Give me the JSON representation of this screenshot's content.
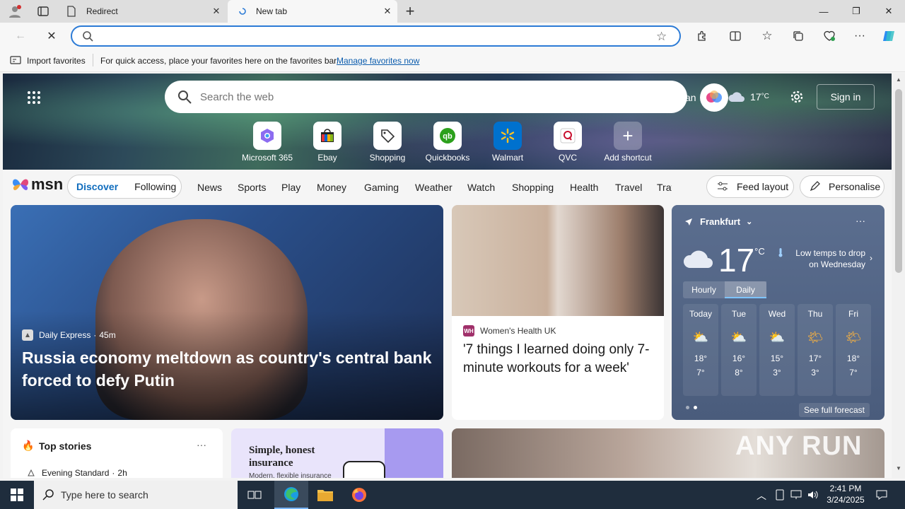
{
  "browser": {
    "tabs": [
      {
        "title": "Redirect",
        "active": false
      },
      {
        "title": "New tab",
        "active": true
      }
    ],
    "address_placeholder": "",
    "favorites_bar": {
      "import_label": "Import favorites",
      "message": "For quick access, place your favorites here on the favorites bar.",
      "manage_link": "Manage favorites now"
    }
  },
  "newtab": {
    "search_placeholder": "Search the web",
    "weather_mini": "17",
    "weather_unit": "°C",
    "signin_label": "Sign in",
    "partial_text": "an",
    "shortcuts": [
      {
        "label": "Microsoft 365",
        "icon": "microsoft-365-icon"
      },
      {
        "label": "Ebay",
        "icon": "ebay-icon"
      },
      {
        "label": "Shopping",
        "icon": "tag-icon"
      },
      {
        "label": "Quickbooks",
        "icon": "quickbooks-icon"
      },
      {
        "label": "Walmart",
        "icon": "walmart-icon"
      },
      {
        "label": "QVC",
        "icon": "qvc-icon"
      },
      {
        "label": "Add shortcut",
        "icon": "plus-icon"
      }
    ]
  },
  "msn": {
    "logo_text": "msn",
    "primary_tabs": [
      "Discover",
      "Following"
    ],
    "nav_links": [
      "News",
      "Sports",
      "Play",
      "Money",
      "Gaming",
      "Weather",
      "Watch",
      "Shopping",
      "Health",
      "Travel",
      "Trav"
    ],
    "feed_layout_label": "Feed layout",
    "personalise_label": "Personalise"
  },
  "cards": {
    "main": {
      "source": "Daily Express",
      "age": "45m",
      "headline": "Russia economy meltdown as country's central bank forced to defy Putin"
    },
    "second": {
      "source": "Women's Health UK",
      "headline": "'7 things I learned doing only 7-minute workouts for a week'"
    },
    "top_stories": {
      "title": "Top stories",
      "more": "···",
      "first_source": "Evening Standard",
      "first_age": "2h"
    },
    "ad": {
      "title": "Simple, honest insurance",
      "sub": "Modern, flexible insurance"
    }
  },
  "weather": {
    "location": "Frankfurt",
    "temp": "17",
    "unit": "°C",
    "alert": "Low temps to drop on Wednesday",
    "tabs": [
      "Hourly",
      "Daily"
    ],
    "days": [
      {
        "day": "Today",
        "high": "18°",
        "low": "7°"
      },
      {
        "day": "Tue",
        "high": "16°",
        "low": "8°"
      },
      {
        "day": "Wed",
        "high": "15°",
        "low": "3°"
      },
      {
        "day": "Thu",
        "high": "17°",
        "low": "3°"
      },
      {
        "day": "Fri",
        "high": "18°",
        "low": "7°"
      }
    ],
    "see_full": "See full forecast"
  },
  "taskbar": {
    "search_placeholder": "Type here to search",
    "time": "2:41 PM",
    "date": "3/24/2025"
  },
  "watermark": "ANY RUN"
}
